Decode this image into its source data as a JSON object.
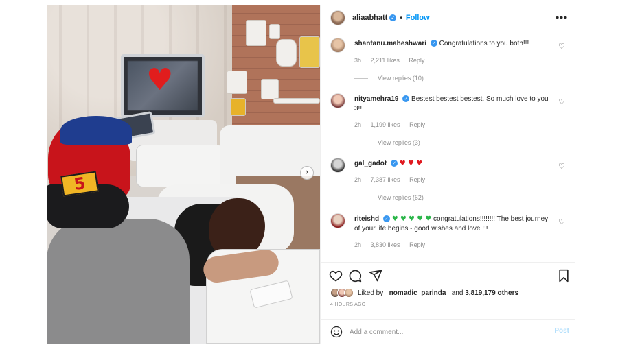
{
  "post": {
    "author": {
      "username": "aliaabhatt",
      "separator": "•",
      "follow_label": "Follow",
      "more_label": "•••"
    },
    "photo": {
      "cap_number": "5",
      "next_arrow": "›"
    },
    "comments": [
      {
        "username": "shantanu.maheshwari",
        "verified": true,
        "text": "Congratulations to you both!!!",
        "time": "3h",
        "likes": "2,211 likes",
        "reply": "Reply",
        "view_replies": "View replies (10)"
      },
      {
        "username": "nityamehra19",
        "verified": true,
        "text": "Bestest bestest bestest. So much love to you 3!!!",
        "time": "2h",
        "likes": "1,199 likes",
        "reply": "Reply",
        "view_replies": "View replies (3)"
      },
      {
        "username": "gal_gadot",
        "verified": true,
        "text": "♥ ♥ ♥",
        "time": "2h",
        "likes": "7,387 likes",
        "reply": "Reply",
        "view_replies": "View replies (62)"
      },
      {
        "username": "riteishd",
        "verified": true,
        "emoji": "♥ ♥ ♥ ♥ ♥",
        "text": "congratulations!!!!!!!! The best journey of your life begins - good wishes and love !!!",
        "time": "2h",
        "likes": "3,830 likes",
        "reply": "Reply"
      }
    ],
    "liked_by": {
      "prefix": "Liked by",
      "user": "_nomadic_parinda_",
      "connector": "and",
      "count": "3,819,179 others"
    },
    "time_ago": "4 HOURS AGO",
    "add_comment": {
      "placeholder": "Add a comment...",
      "post_label": "Post"
    },
    "colors": {
      "link_blue": "#0095f6",
      "verified_blue": "#3897f0",
      "muted": "#8e8e8e",
      "heart_red": "#e0191f",
      "heart_green": "#2bb64a"
    },
    "icons": [
      "verified-icon",
      "more-icon",
      "heart-icon",
      "comment-icon",
      "share-icon",
      "bookmark-icon",
      "emoji-icon",
      "chevron-right-icon"
    ]
  }
}
